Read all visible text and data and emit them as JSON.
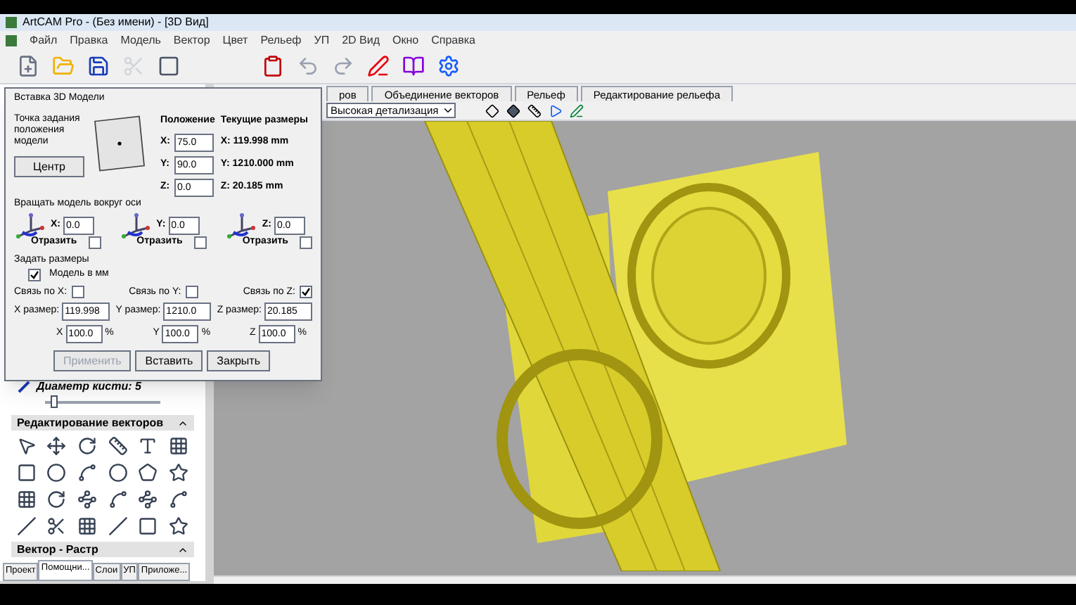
{
  "window": {
    "title": "ArtCAM Pro - (Без имени) - [3D Вид]"
  },
  "menu": [
    "Файл",
    "Правка",
    "Модель",
    "Вектор",
    "Цвет",
    "Рельеф",
    "УП",
    "2D Вид",
    "Окно",
    "Справка"
  ],
  "tabs": [
    {
      "label": "ров",
      "selected": false
    },
    {
      "label": "Объединение векторов",
      "selected": false
    },
    {
      "label": "Рельеф",
      "selected": false
    },
    {
      "label": "Редактирование рельефа",
      "selected": false
    }
  ],
  "view_toolbar": {
    "detail": "Высокая детализация"
  },
  "dialog": {
    "title": "Вставка 3D Модели",
    "anchor_label": "Точка задания положения модели",
    "center_button": "Центр",
    "position_heading": "Положение",
    "current_heading": "Текущие размеры",
    "position": [
      {
        "label": "X:",
        "value": "75.0"
      },
      {
        "label": "Y:",
        "value": "90.0"
      },
      {
        "label": "Z:",
        "value": "0.0"
      }
    ],
    "current": [
      "X: 119.998 mm",
      "Y: 1210.000 mm",
      "Z: 20.185 mm"
    ],
    "rotate_heading": "Вращать модель вокруг оси",
    "rotate": [
      {
        "label": "X:",
        "value": "0.0",
        "mirror": "Отразить",
        "checked": false
      },
      {
        "label": "Y:",
        "value": "0.0",
        "mirror": "Отразить",
        "checked": false
      },
      {
        "label": "Z:",
        "value": "0.0",
        "mirror": "Отразить",
        "checked": false
      }
    ],
    "size_heading": "Задать размеры",
    "mm": {
      "label": "Модель в мм",
      "checked": true
    },
    "links": [
      {
        "label": "Связь по X:",
        "checked": false
      },
      {
        "label": "Связь по Y:",
        "checked": false
      },
      {
        "label": "Связь по Z:",
        "checked": true
      }
    ],
    "sizes": [
      {
        "label": "X размер:",
        "value": "119.998"
      },
      {
        "label": "Y размер:",
        "value": "1210.0"
      },
      {
        "label": "Z размер:",
        "value": "20.185"
      }
    ],
    "percents": [
      {
        "label": "X",
        "value": "100.0",
        "unit": "%"
      },
      {
        "label": "Y",
        "value": "100.0",
        "unit": "%"
      },
      {
        "label": "Z",
        "value": "100.0",
        "unit": "%"
      }
    ],
    "buttons": [
      {
        "label": "Применить",
        "disabled": true
      },
      {
        "label": "Вставить",
        "disabled": false
      },
      {
        "label": "Закрыть",
        "disabled": false
      }
    ]
  },
  "left_panel": {
    "brush": {
      "label": "Диаметр кисти:",
      "value": "5",
      "level": 0.05
    },
    "sections": [
      "Редактирование векторов",
      "Вектор - Растр"
    ],
    "tabs": [
      {
        "label": "Проект",
        "selected": false
      },
      {
        "label": "Помощни...",
        "selected": true
      },
      {
        "label": "Слои",
        "selected": false
      },
      {
        "label": "УП",
        "selected": false
      },
      {
        "label": "Приложе...",
        "selected": false
      }
    ]
  }
}
